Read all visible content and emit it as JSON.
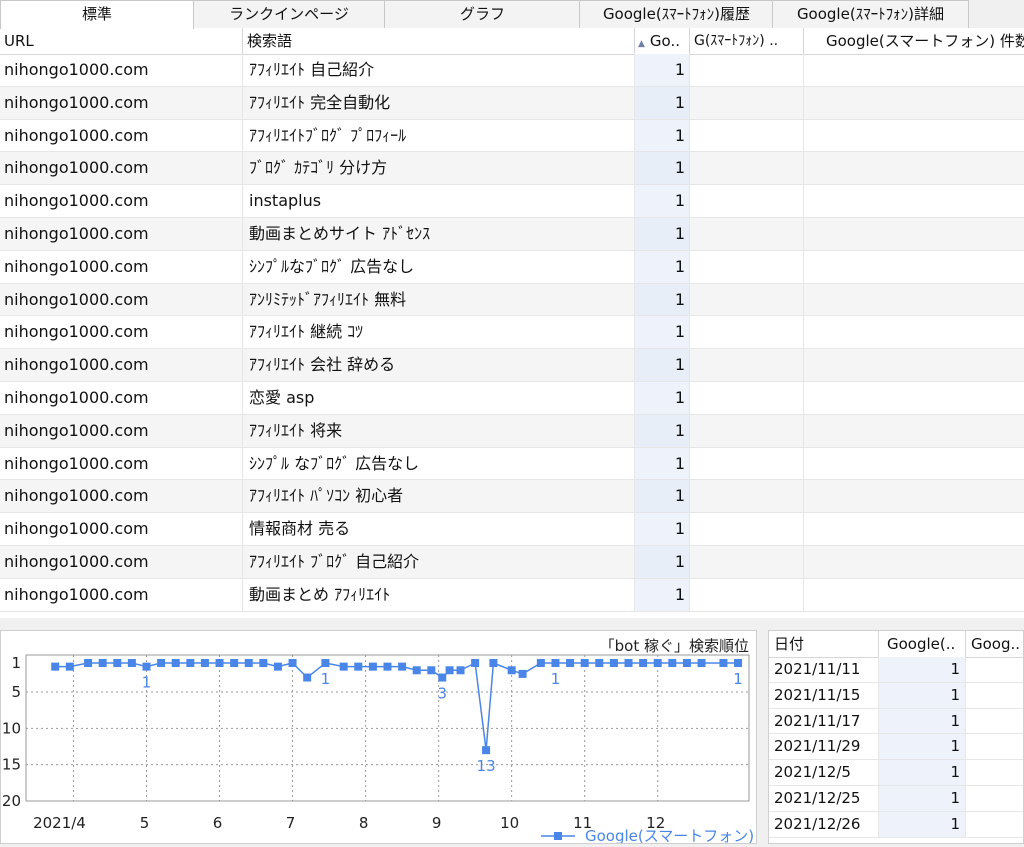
{
  "tabs": [
    "標準",
    "ランクインページ",
    "グラフ",
    "Google(ｽﾏｰﾄﾌｫﾝ)履歴",
    "Google(ｽﾏｰﾄﾌｫﾝ)詳細"
  ],
  "grid": {
    "headers": [
      "URL",
      "検索語",
      "Go..",
      "G(ｽﾏｰﾄﾌｫﾝ) ..",
      "Google(スマートフォン) 件数"
    ],
    "rows": [
      {
        "url": "nihongo1000.com",
        "kw": "ｱﾌｨﾘｴｲﾄ 自己紹介",
        "rank": "1"
      },
      {
        "url": "nihongo1000.com",
        "kw": "ｱﾌｨﾘｴｲﾄ 完全自動化",
        "rank": "1"
      },
      {
        "url": "nihongo1000.com",
        "kw": "ｱﾌｨﾘｴｲﾄﾌﾞﾛｸﾞ ﾌﾟﾛﾌｨｰﾙ",
        "rank": "1"
      },
      {
        "url": "nihongo1000.com",
        "kw": "ﾌﾞﾛｸﾞ ｶﾃｺﾞﾘ 分け方",
        "rank": "1"
      },
      {
        "url": "nihongo1000.com",
        "kw": "instaplus",
        "rank": "1"
      },
      {
        "url": "nihongo1000.com",
        "kw": "動画まとめサイト ｱﾄﾞｾﾝｽ",
        "rank": "1"
      },
      {
        "url": "nihongo1000.com",
        "kw": "ｼﾝﾌﾟﾙなﾌﾞﾛｸﾞ 広告なし",
        "rank": "1"
      },
      {
        "url": "nihongo1000.com",
        "kw": "ｱﾝﾘﾐﾃｯﾄﾞｱﾌｨﾘｴｲﾄ 無料",
        "rank": "1"
      },
      {
        "url": "nihongo1000.com",
        "kw": "ｱﾌｨﾘｴｲﾄ 継続 ｺﾂ",
        "rank": "1"
      },
      {
        "url": "nihongo1000.com",
        "kw": "ｱﾌｨﾘｴｲﾄ 会社 辞める",
        "rank": "1"
      },
      {
        "url": "nihongo1000.com",
        "kw": "恋愛 asp",
        "rank": "1"
      },
      {
        "url": "nihongo1000.com",
        "kw": "ｱﾌｨﾘｴｲﾄ 将来",
        "rank": "1"
      },
      {
        "url": "nihongo1000.com",
        "kw": "ｼﾝﾌﾟﾙ なﾌﾞﾛｸﾞ 広告なし",
        "rank": "1"
      },
      {
        "url": "nihongo1000.com",
        "kw": "ｱﾌｨﾘｴｲﾄ ﾊﾟｿｺﾝ 初心者",
        "rank": "1"
      },
      {
        "url": "nihongo1000.com",
        "kw": "情報商材 売る",
        "rank": "1"
      },
      {
        "url": "nihongo1000.com",
        "kw": "ｱﾌｨﾘｴｲﾄ ﾌﾞﾛｸﾞ 自己紹介",
        "rank": "1"
      },
      {
        "url": "nihongo1000.com",
        "kw": "動画まとめ ｱﾌｨﾘｴｲﾄ",
        "rank": "1"
      }
    ]
  },
  "chart_data": {
    "type": "line",
    "title": "「bot 稼ぐ」検索順位",
    "xlabel": "",
    "ylabel": "",
    "xtick_labels": [
      "2021/4",
      "5",
      "6",
      "7",
      "8",
      "9",
      "10",
      "11",
      "12"
    ],
    "ytick_labels": [
      "1",
      "5",
      "10",
      "15",
      "20"
    ],
    "ylim": [
      1,
      20
    ],
    "y_inverted": true,
    "grid": true,
    "legend": "bottom-right",
    "series": [
      {
        "name": "Google(スマートフォン)",
        "color": "#4a86e8",
        "x": [
          3.75,
          3.95,
          4.2,
          4.4,
          4.6,
          4.8,
          5.0,
          5.2,
          5.4,
          5.6,
          5.8,
          6.0,
          6.2,
          6.4,
          6.6,
          6.8,
          7.0,
          7.2,
          7.45,
          7.7,
          7.9,
          8.1,
          8.3,
          8.5,
          8.7,
          8.9,
          9.05,
          9.15,
          9.3,
          9.5,
          9.65,
          9.75,
          10.0,
          10.15,
          10.4,
          10.6,
          10.8,
          11.0,
          11.2,
          11.4,
          11.6,
          11.8,
          12.0,
          12.2,
          12.4,
          12.6,
          12.9,
          13.1
        ],
        "y": [
          1.5,
          1.5,
          1,
          1,
          1,
          1,
          1.5,
          1,
          1,
          1,
          1,
          1,
          1,
          1,
          1,
          1.5,
          1,
          3,
          1,
          1.5,
          1.5,
          1.5,
          1.5,
          1.5,
          2,
          2,
          3,
          2,
          2,
          1,
          13,
          1,
          2,
          2.5,
          1,
          1,
          1,
          1,
          1,
          1,
          1,
          1,
          1,
          1,
          1,
          1,
          1,
          1
        ],
        "annotations": [
          {
            "x": 5.0,
            "y": 1.5,
            "text": "1"
          },
          {
            "x": 7.45,
            "y": 1,
            "text": "1"
          },
          {
            "x": 9.05,
            "y": 3,
            "text": "3"
          },
          {
            "x": 9.65,
            "y": 13,
            "text": "13"
          },
          {
            "x": 10.6,
            "y": 1,
            "text": "1"
          },
          {
            "x": 13.1,
            "y": 1,
            "text": "1"
          }
        ]
      }
    ]
  },
  "history": {
    "headers": [
      "日付",
      "Google(..",
      "Goog.."
    ],
    "rows": [
      {
        "date": "2021/11/11",
        "val": "1"
      },
      {
        "date": "2021/11/15",
        "val": "1"
      },
      {
        "date": "2021/11/17",
        "val": "1"
      },
      {
        "date": "2021/11/29",
        "val": "1"
      },
      {
        "date": "2021/12/5",
        "val": "1"
      },
      {
        "date": "2021/12/25",
        "val": "1"
      },
      {
        "date": "2021/12/26",
        "val": "1"
      }
    ]
  }
}
